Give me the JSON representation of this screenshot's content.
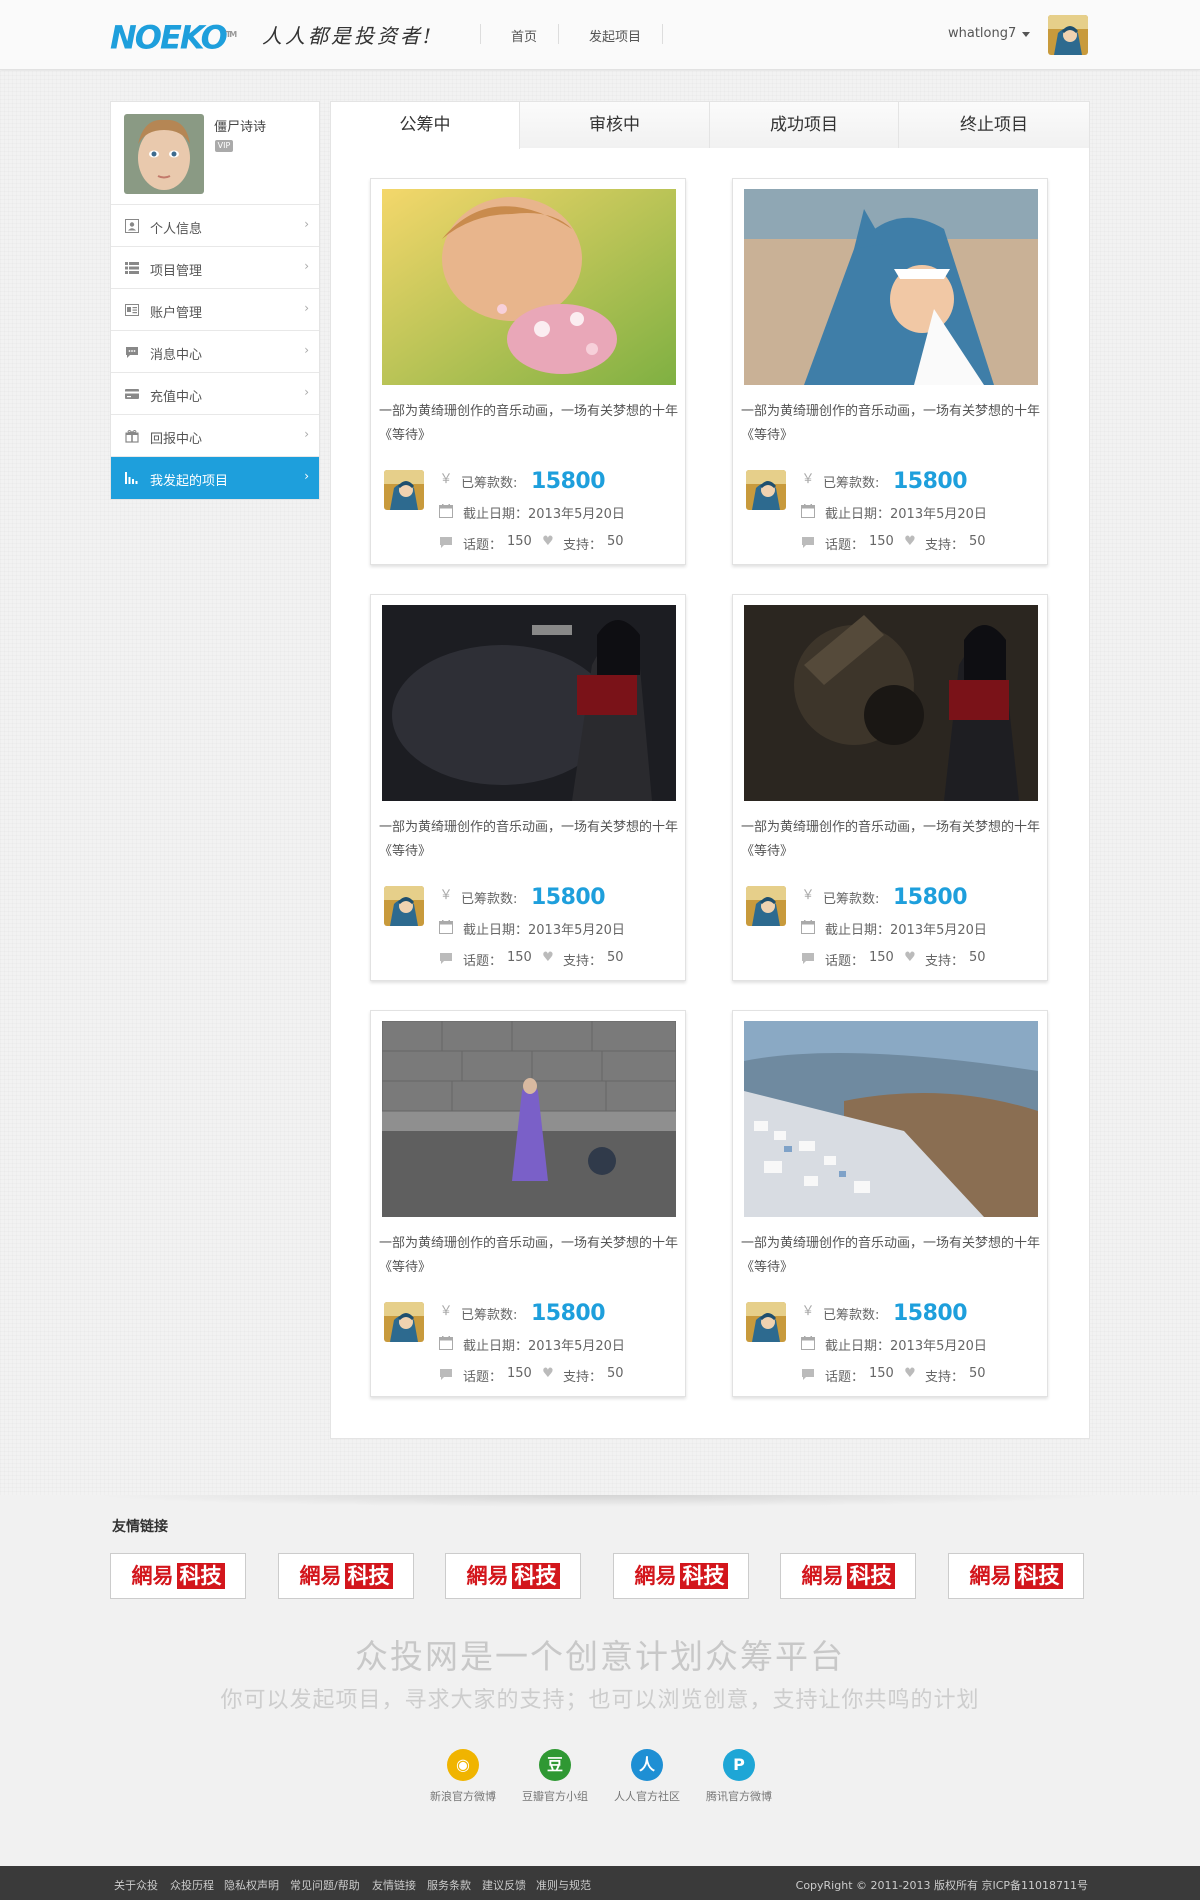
{
  "header": {
    "logo": "NOEKO",
    "logo_tm": "TM",
    "slogan": "人人都是投资者!",
    "nav": [
      {
        "label": "首页"
      },
      {
        "label": "发起项目"
      }
    ],
    "username": "whatlong7"
  },
  "sidebar": {
    "profile_name": "僵尸诗诗",
    "vip": "VIP",
    "items": [
      {
        "label": "个人信息",
        "icon": "user-card-icon"
      },
      {
        "label": "项目管理",
        "icon": "list-icon"
      },
      {
        "label": "账户管理",
        "icon": "id-card-icon"
      },
      {
        "label": "消息中心",
        "icon": "chat-bubble-icon"
      },
      {
        "label": "充值中心",
        "icon": "credit-card-icon"
      },
      {
        "label": "回报中心",
        "icon": "gift-icon"
      },
      {
        "label": "我发起的项目",
        "icon": "bar-chart-icon",
        "active": true
      }
    ],
    "arrow": "›"
  },
  "tabs": [
    {
      "label": "公筹中",
      "active": true
    },
    {
      "label": "审核中"
    },
    {
      "label": "成功项目"
    },
    {
      "label": "终止项目"
    }
  ],
  "cards": [
    {
      "image": "girl-with-flowers",
      "desc": "一部为黄绮珊创作的音乐动画，一场有关梦想的十年《等待》",
      "raised_label": "已筹款数:",
      "amount": "15800",
      "deadline": "截止日期：2013年5月20日",
      "topic_label": "话题：",
      "topic": "150",
      "support_label": "支持：",
      "support": "50"
    },
    {
      "image": "baby-in-shark-costume",
      "desc": "一部为黄绮珊创作的音乐动画，一场有关梦想的十年《等待》",
      "raised_label": "已筹款数:",
      "amount": "15800",
      "deadline": "截止日期：2013年5月20日",
      "topic_label": "话题：",
      "topic": "150",
      "support_label": "支持：",
      "support": "50"
    },
    {
      "image": "game-character-gun",
      "desc": "一部为黄绮珊创作的音乐动画，一场有关梦想的十年《等待》",
      "raised_label": "已筹款数:",
      "amount": "15800",
      "deadline": "截止日期：2013年5月20日",
      "topic_label": "话题：",
      "topic": "150",
      "support_label": "支持：",
      "support": "50"
    },
    {
      "image": "game-character-machine",
      "desc": "一部为黄绮珊创作的音乐动画，一场有关梦想的十年《等待》",
      "raised_label": "已筹款数:",
      "amount": "15800",
      "deadline": "截止日期：2013年5月20日",
      "topic_label": "话题：",
      "topic": "150",
      "support_label": "支持：",
      "support": "50"
    },
    {
      "image": "street-flute-player",
      "desc": "一部为黄绮珊创作的音乐动画，一场有关梦想的十年《等待》",
      "raised_label": "已筹款数:",
      "amount": "15800",
      "deadline": "截止日期：2013年5月20日",
      "topic_label": "话题：",
      "topic": "150",
      "support_label": "支持：",
      "support": "50"
    },
    {
      "image": "santorini-coast",
      "desc": "一部为黄绮珊创作的音乐动画，一场有关梦想的十年《等待》",
      "raised_label": "已筹款数:",
      "amount": "15800",
      "deadline": "截止日期：2013年5月20日",
      "topic_label": "话题：",
      "topic": "150",
      "support_label": "支持：",
      "support": "50"
    }
  ],
  "icons": {
    "yen": "￥",
    "calendar": "17",
    "chat": "▬",
    "heart": "♥"
  },
  "friend_links": {
    "title": "友情链接",
    "logo_prefix": "網易",
    "logo_box": "科技",
    "count": 6
  },
  "tagline": {
    "main": "众投网是一个创意计划众筹平台",
    "sub": "你可以发起项目，寻求大家的支持；也可以浏览创意，支持让你共鸣的计划"
  },
  "social": [
    {
      "label": "新浪官方微博",
      "icon": "weibo-icon",
      "glyph": "◉",
      "color": "#f0b400"
    },
    {
      "label": "豆瓣官方小组",
      "icon": "douban-icon",
      "glyph": "豆",
      "color": "#2f9833"
    },
    {
      "label": "人人官方社区",
      "icon": "renren-icon",
      "glyph": "人",
      "color": "#1e8fd4"
    },
    {
      "label": "腾讯官方微博",
      "icon": "tencent-weibo-icon",
      "glyph": "P",
      "color": "#1ea6d6"
    }
  ],
  "footer": {
    "links": [
      "关于众投",
      "众投历程",
      "隐私权声明",
      "常见问题/帮助",
      "友情链接",
      "服务条款",
      "建议反馈",
      "准则与规范"
    ],
    "copyright": "CopyRight © 2011-2013    版权所有  京ICP备11018711号"
  },
  "colors": {
    "accent": "#1e9fdc",
    "brand_red": "#d3161c",
    "footer_bg": "#3a3a3a"
  }
}
